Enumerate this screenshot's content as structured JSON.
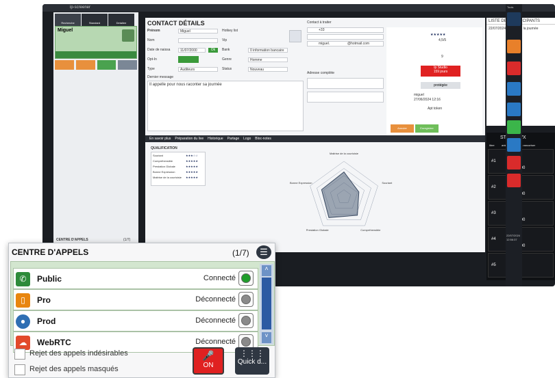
{
  "window": {
    "app_title": "ip-screener",
    "tab": "ip-screener"
  },
  "left": {
    "tabs": [
      "Recherche",
      "Standard",
      "Detailee"
    ],
    "card": {
      "name": "Miguel"
    },
    "footer": "CENTRE D'APPELS",
    "footer_count": "(1/7)"
  },
  "main": {
    "header_tab": "Miguel Dos Santos Abru Fousi",
    "title": "CONTACT DÉTAILS",
    "labels": {
      "prenom": "Prénom",
      "nom": "Nom",
      "naissance": "Date de naissa",
      "optin": "Opt-In",
      "type": "Type",
      "hotkey": "Hotkey list",
      "vip": "Vip",
      "bank": "Bank",
      "genre": "Genre",
      "status": "Status",
      "contact": "Contact à traiter",
      "adresse": "Adresse complète",
      "message_label": "Dernier message"
    },
    "values": {
      "prenom": "Miguel",
      "date": "11/07/2000",
      "ok": "Ok",
      "bank": "0 information bancaire",
      "genre": "Homme",
      "type": "Auditeurs",
      "status": "Nouveau",
      "phone_code": "+33",
      "email": "miguel.",
      "email_domain": "@hotmail.com",
      "message": "Il appelle pour nous raconter sa journée"
    },
    "stats": {
      "stars": "★★★★★",
      "rating": "4,5/5",
      "calls": "9",
      "badge": "Ip Studio",
      "badge_sub": "159 jours",
      "protege": "protégée",
      "author": "miguel",
      "date_log": "27/06/2024 12:16",
      "apt": "Apt token"
    },
    "actions": {
      "annuler": "Annuler",
      "enregistrer": "Enregistrer"
    },
    "bottom_tabs": [
      "En savoir plus",
      "Préparation du live",
      "Historique",
      "Partage",
      "Logo",
      "Bloc-notes"
    ],
    "qualification_title": "QUALIFICATION",
    "qualification": [
      {
        "label": "Souriant",
        "stars": "★★★☆☆"
      },
      {
        "label": "Compréhensible",
        "stars": "★★★★★"
      },
      {
        "label": "Prestation Globale",
        "stars": "★★★★★"
      },
      {
        "label": "Bonne Expression",
        "stars": "★★★★★"
      },
      {
        "label": "Maitrise de la courtoisie",
        "stars": "★★★★★"
      }
    ],
    "radar_labels": [
      "Maitrise de la courtoisie",
      "Souriant",
      "Compréhensible",
      "Prestation Globale",
      "Bonne Expression"
    ],
    "radar_values": [
      3.5,
      2.2,
      3.2,
      3.6,
      3.3
    ]
  },
  "participants": {
    "title": "LISTE DES PARTICIPANTS",
    "date": "22/07/2024",
    "scope": "Toute la journée"
  },
  "studio": {
    "title": "STUDIO VX",
    "tabs": [
      "libre",
      "animateur",
      "à rancoriser"
    ],
    "slots": [
      {
        "id": "#1",
        "time": "00:00:00"
      },
      {
        "id": "#2",
        "time": "00:00:00"
      },
      {
        "id": "#3",
        "time": "00:00:00"
      },
      {
        "id": "#4",
        "time": "00:00:00"
      },
      {
        "id": "#5",
        "time": ""
      }
    ]
  },
  "rightbar": {
    "label": "Tools",
    "items": [
      "ip",
      "intercom",
      "screener",
      "presales",
      "ip-chat",
      "recherche",
      "ip-plan",
      "ip-client"
    ],
    "time": "12:56:37",
    "date": "22/07/2024",
    "version": "2024.1.1.1"
  },
  "callcenter": {
    "title": "CENTRE D'APPELS",
    "count": "(1/7)",
    "lines": [
      {
        "name": "Public",
        "status": "Connecté",
        "color": "#2e8b3a"
      },
      {
        "name": "Pro",
        "status": "Déconnecté",
        "color": "#e8860f"
      },
      {
        "name": "Prod",
        "status": "Déconnecté",
        "color": "#2f6fb3"
      },
      {
        "name": "WebRTC",
        "status": "Déconnecté",
        "color": "#e24a2a"
      }
    ],
    "options": [
      "Rejet des appels indésirables",
      "Rejet des appels masqués"
    ],
    "on": "ON",
    "quick": "Quick d..."
  },
  "colors": {
    "connected": "#1f9d2a",
    "disconnected": "#8a8a8a",
    "accent_red": "#e02121"
  }
}
